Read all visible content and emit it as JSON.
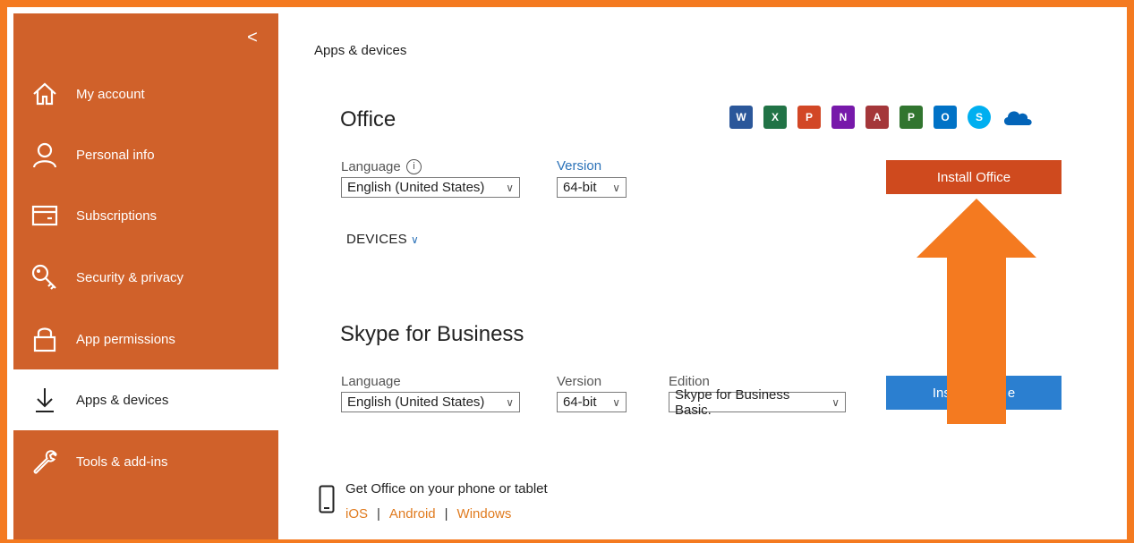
{
  "sidebar": {
    "collapse_label": "<",
    "items": [
      {
        "label": "My account",
        "icon": "home-icon"
      },
      {
        "label": "Personal info",
        "icon": "person-icon"
      },
      {
        "label": "Subscriptions",
        "icon": "card-icon"
      },
      {
        "label": "Security & privacy",
        "icon": "key-icon"
      },
      {
        "label": "App permissions",
        "icon": "lock-icon"
      },
      {
        "label": "Apps & devices",
        "icon": "download-icon",
        "active": true
      },
      {
        "label": "Tools & add-ins",
        "icon": "wrench-icon"
      }
    ]
  },
  "main": {
    "breadcrumb": "Apps & devices",
    "office": {
      "title": "Office",
      "language_label": "Language",
      "language_value": "English (United States)",
      "version_label": "Version",
      "version_value": "64-bit",
      "devices_label": "DEVICES",
      "install_button": "Install Office",
      "app_icons": [
        {
          "name": "word-icon",
          "letter": "W",
          "color": "#2b579a"
        },
        {
          "name": "excel-icon",
          "letter": "X",
          "color": "#217346"
        },
        {
          "name": "powerpoint-icon",
          "letter": "P",
          "color": "#d24726"
        },
        {
          "name": "onenote-icon",
          "letter": "N",
          "color": "#7719aa"
        },
        {
          "name": "access-icon",
          "letter": "A",
          "color": "#a4373a"
        },
        {
          "name": "project-icon",
          "letter": "P",
          "color": "#31752f"
        },
        {
          "name": "outlook-icon",
          "letter": "O",
          "color": "#0072c6"
        },
        {
          "name": "skype-icon",
          "letter": "S",
          "color": "#00aff0"
        },
        {
          "name": "onedrive-icon",
          "letter": "",
          "color": "#0364b8"
        }
      ]
    },
    "skype": {
      "title": "Skype for Business",
      "language_label": "Language",
      "language_value": "English (United States)",
      "version_label": "Version",
      "version_value": "64-bit",
      "edition_label": "Edition",
      "edition_value": "Skype for Business Basic.",
      "install_button_left": "Ins",
      "install_button_right": "e"
    },
    "mobile": {
      "text": "Get Office on your phone or tablet",
      "links": [
        "iOS",
        "Android",
        "Windows"
      ],
      "separator": "|"
    }
  },
  "colors": {
    "sidebar": "#d0612a",
    "frame": "#f47a20",
    "install_office": "#cf4a1e",
    "install_skype": "#2b7fd0",
    "link": "#e07b1f"
  }
}
